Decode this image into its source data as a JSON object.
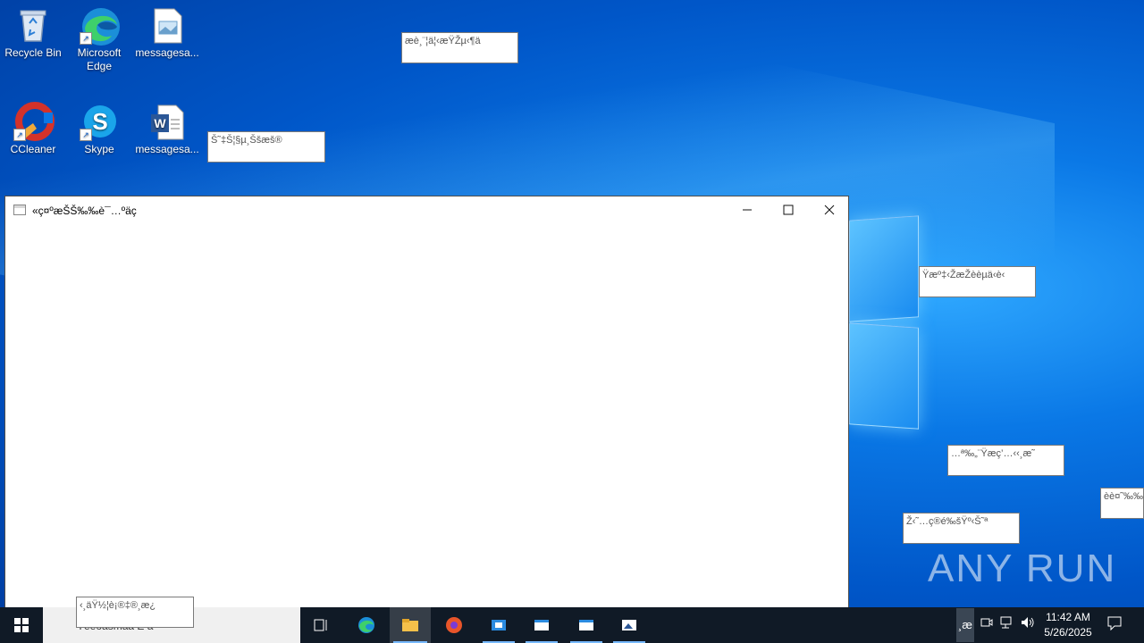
{
  "desktop": {
    "icons": [
      {
        "label": "Recycle Bin"
      },
      {
        "label": "Microsoft Edge"
      },
      {
        "label": "messagesa..."
      },
      {
        "label": "CCleaner"
      },
      {
        "label": "Skype"
      },
      {
        "label": "messagesa..."
      }
    ],
    "popups": [
      "æè¸¨¦ä¦‹æŸŽµ‹¶ä",
      "Š˜‡Š¦§µ¸Ššæš®",
      "Ÿæº‡‹ŽæŽèèµä‹è‹",
      "…ª‰„¨Ÿæç’…‹‹¸æ˜",
      "èè¤˜‰‰ö",
      "Ž‹˜…ç®é‰šŸº‹Š˜ª",
      "‹¸äŸ½¦è¡®‡®¸æ¿"
    ]
  },
  "window": {
    "title": "«ç¤ºæŠŠ‰‰è¯…ºäç"
  },
  "taskbar": {
    "search_text": "Ýëëõäsmàá È ä—­",
    "time": "11:42 AM",
    "date": "5/26/2025",
    "tray_text": "¸æ"
  },
  "watermark": "ANY RUN",
  "colors": {
    "desktop_blue": "#0a78e6",
    "taskbar": "#101a26",
    "accent_underline": "#77b9ff"
  }
}
